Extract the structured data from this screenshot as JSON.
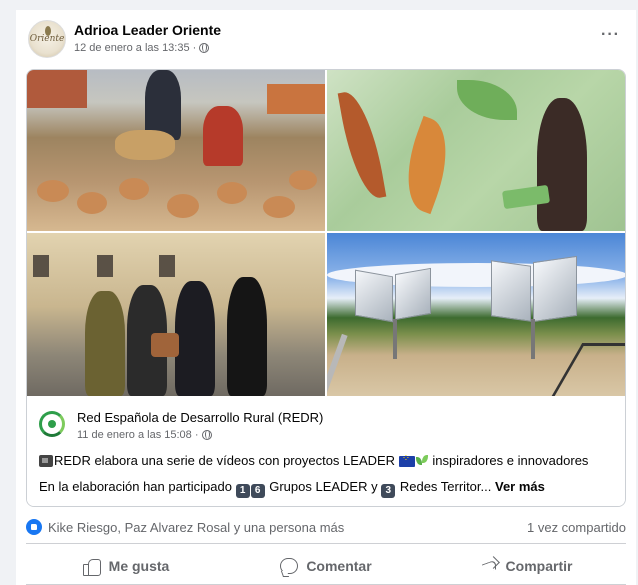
{
  "post": {
    "page_name": "Adrioa Leader Oriente",
    "timestamp": "12 de enero a las 13:35 ·",
    "avatar_text": "Oriente",
    "more_label": "···"
  },
  "shared": {
    "page_name": "Red Española de Desarrollo Rural (REDR)",
    "timestamp": "11 de enero a las 15:08 ·",
    "text_a": "REDR elabora una serie de vídeos con proyectos LEADER",
    "text_b": "inspiradores e innovadores",
    "text_c": "En la elaboración han participado",
    "num_1": "1",
    "num_6": "6",
    "text_d": "Grupos LEADER y",
    "num_3": "3",
    "text_e": "Redes Territor...",
    "see_more": "Ver más"
  },
  "reactions": {
    "names": "Kike Riesgo, Paz Alvarez Rosal y una persona más",
    "shares": "1 vez compartido"
  },
  "actions": {
    "like": "Me gusta",
    "comment": "Comentar",
    "share": "Compartir"
  },
  "colors": {
    "accent": "#1877f2",
    "secondary_text": "#65676b",
    "redr_green": "#2e9e4a"
  },
  "icons": [
    "globe-icon",
    "more-icon",
    "film-icon",
    "eu-flag-icon",
    "sprout-icon",
    "like-badge-icon",
    "thumb-icon",
    "comment-icon",
    "share-icon"
  ]
}
